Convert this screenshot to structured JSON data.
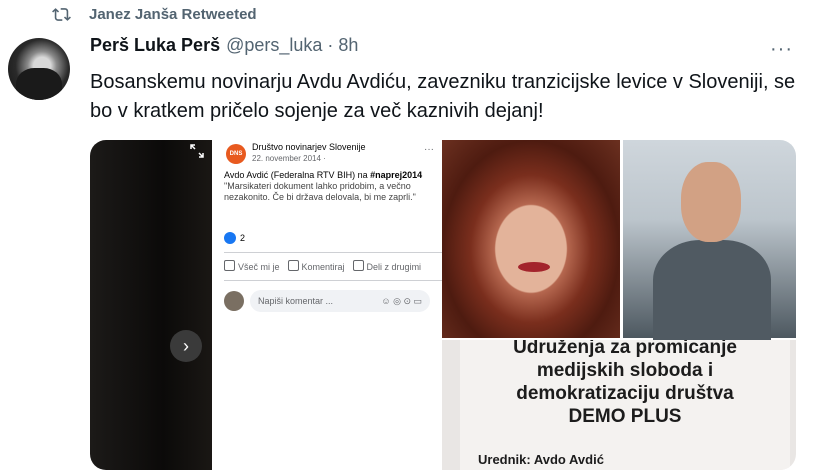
{
  "retweet": {
    "label": "Janez Janša Retweeted"
  },
  "tweet": {
    "name": "Perš Luka Perš",
    "handle": "@pers_luka",
    "separator": "·",
    "time": "8h",
    "more": "···",
    "text": "Bosanskemu novinarju Avdu Avdiću, zavezniku tranzicijske levice v Sloveniji, se bo v kratkem pričelo sojenje za več kaznivih dejanj!"
  },
  "media": {
    "nav_next": "›",
    "fb": {
      "logo_text": "DNS",
      "page_name": "Društvo novinarjev Slovenije",
      "date": "22. november 2014 · ",
      "menu": "···",
      "author": "Avdo Avdić (Federalna RTV BIH) na ",
      "hashtag": "#naprej2014",
      "quote": "\"Marsikateri dokument lahko pridobim, a večno nezakonito. Če bi država delovala, bi me zaprli.\"",
      "likes": "2",
      "action_like": "Všeč mi je",
      "action_comment": "Komentiraj",
      "action_share": "Deli z drugimi",
      "comment_placeholder": "Napiši komentar ...",
      "comment_icons": "☺ ◎ ⊙ ▭"
    },
    "doc": {
      "line1": "Udruženja za promicanje",
      "line2": "medijskih sloboda i",
      "line3": "demokratizaciju društva",
      "line4": "DEMO PLUS",
      "editor": "Urednik: Avdo Avdić"
    }
  },
  "colors": {
    "accent": "#1d9bf0",
    "muted": "#536471",
    "text": "#0f1419"
  }
}
